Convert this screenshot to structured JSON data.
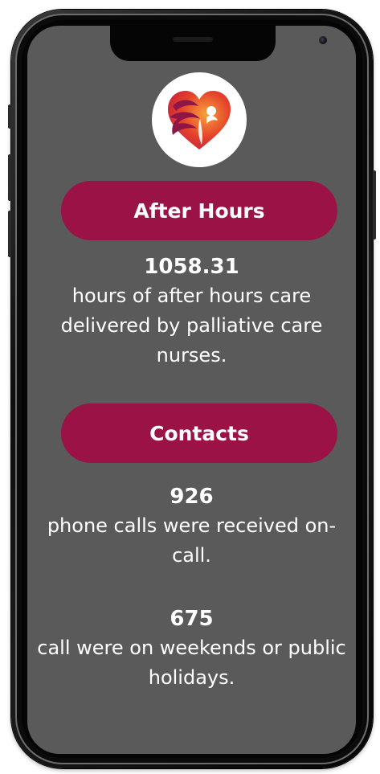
{
  "colors": {
    "screen_bg": "#5a5a5a",
    "pill_bg": "#9a1246",
    "text": "#ffffff",
    "logo_heart": "#e24a2a",
    "logo_figure": "#8e1646"
  },
  "logo": {
    "icon": "heart-figure-logo-icon"
  },
  "sections": [
    {
      "heading": "After Hours",
      "stats": [
        {
          "value": "1058.31",
          "text": "hours of after hours care delivered by palliative care nurses."
        }
      ]
    },
    {
      "heading": "Contacts",
      "stats": [
        {
          "value": "926",
          "text": "phone calls were received on-call."
        },
        {
          "value": "675",
          "text": "call were on weekends or public holidays."
        }
      ]
    }
  ]
}
